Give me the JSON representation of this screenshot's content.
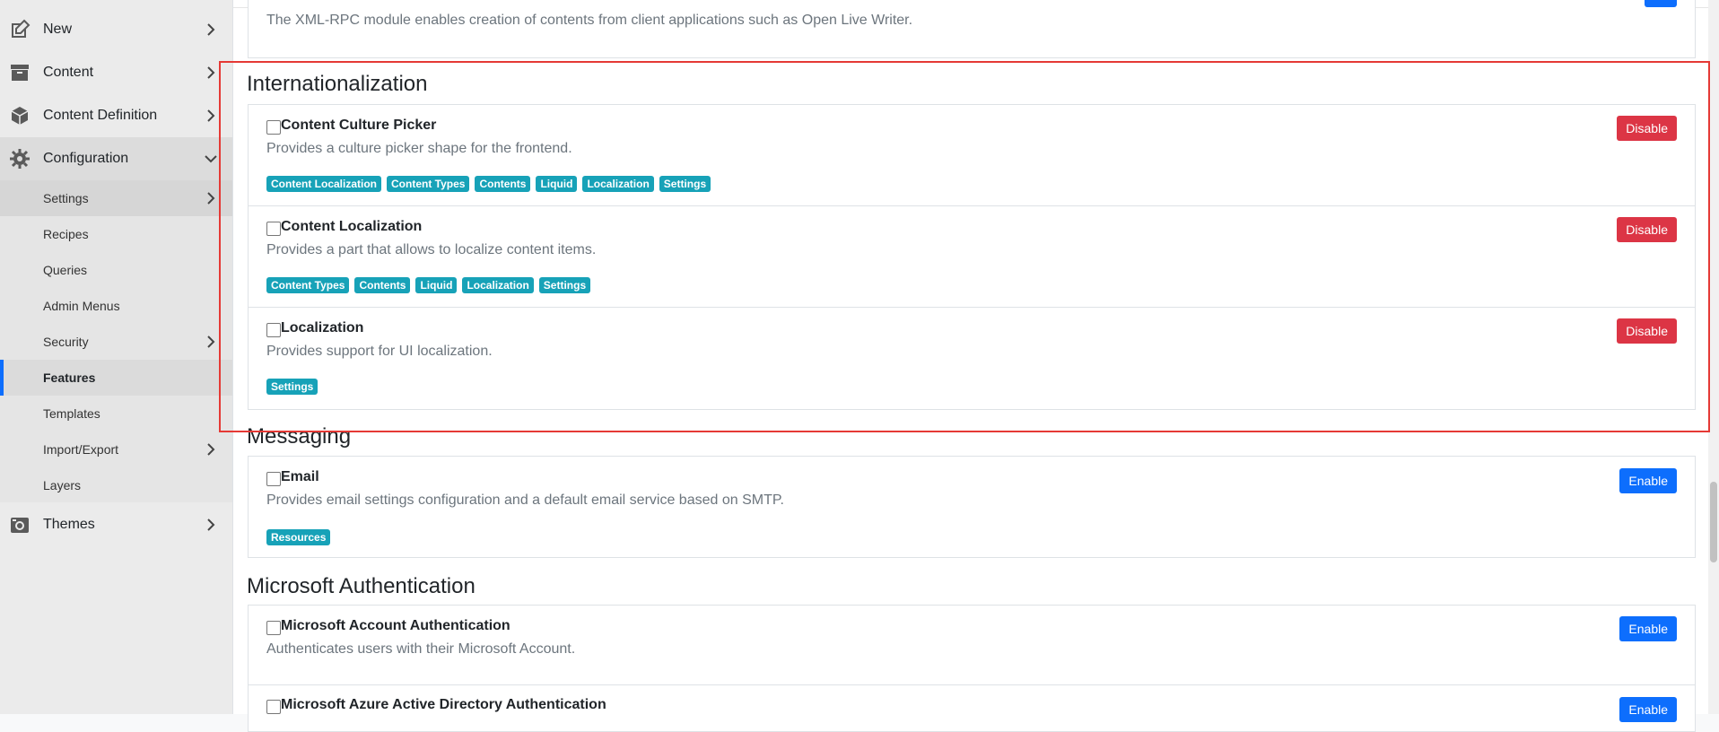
{
  "sidebar": {
    "items": [
      {
        "label": "New",
        "icon": "edit-icon"
      },
      {
        "label": "Content",
        "icon": "archive-icon"
      },
      {
        "label": "Content Definition",
        "icon": "cube-icon"
      },
      {
        "label": "Configuration",
        "icon": "gear-icon"
      },
      {
        "label": "Themes",
        "icon": "camera-icon"
      }
    ],
    "sub_items": [
      {
        "label": "Settings"
      },
      {
        "label": "Recipes"
      },
      {
        "label": "Queries"
      },
      {
        "label": "Admin Menus"
      },
      {
        "label": "Security"
      },
      {
        "label": "Features"
      },
      {
        "label": "Templates"
      },
      {
        "label": "Import/Export"
      },
      {
        "label": "Layers"
      }
    ]
  },
  "top_feature": {
    "desc": "The XML-RPC module enables creation of contents from client applications such as Open Live Writer."
  },
  "sections": {
    "internationalization": {
      "title": "Internationalization",
      "features": [
        {
          "name": "Content Culture Picker",
          "desc": "Provides a culture picker shape for the frontend.",
          "tags": [
            "Content Localization",
            "Content Types",
            "Contents",
            "Liquid",
            "Localization",
            "Settings"
          ],
          "button": "Disable"
        },
        {
          "name": "Content Localization",
          "desc": "Provides a part that allows to localize content items.",
          "tags": [
            "Content Types",
            "Contents",
            "Liquid",
            "Localization",
            "Settings"
          ],
          "button": "Disable"
        },
        {
          "name": "Localization",
          "desc": "Provides support for UI localization.",
          "tags": [
            "Settings"
          ],
          "button": "Disable"
        }
      ]
    },
    "messaging": {
      "title": "Messaging",
      "features": [
        {
          "name": "Email",
          "desc": "Provides email settings configuration and a default email service based on SMTP.",
          "tags": [
            "Resources"
          ],
          "button": "Enable"
        }
      ]
    },
    "microsoft": {
      "title": "Microsoft Authentication",
      "features": [
        {
          "name": "Microsoft Account Authentication",
          "desc": "Authenticates users with their Microsoft Account.",
          "button": "Enable"
        },
        {
          "name": "Microsoft Azure Active Directory Authentication",
          "button": "Enable"
        }
      ]
    }
  },
  "colors": {
    "danger": "#dc3545",
    "primary": "#0d6efd",
    "tag": "#17a2b8",
    "highlight": "#e53935"
  }
}
